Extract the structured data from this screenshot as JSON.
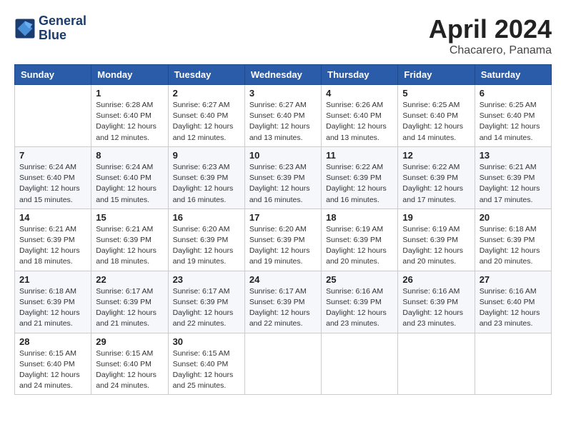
{
  "header": {
    "logo_line1": "General",
    "logo_line2": "Blue",
    "month": "April 2024",
    "location": "Chacarero, Panama"
  },
  "days_of_week": [
    "Sunday",
    "Monday",
    "Tuesday",
    "Wednesday",
    "Thursday",
    "Friday",
    "Saturday"
  ],
  "weeks": [
    [
      {
        "day": "",
        "sunrise": "",
        "sunset": "",
        "daylight": ""
      },
      {
        "day": "1",
        "sunrise": "Sunrise: 6:28 AM",
        "sunset": "Sunset: 6:40 PM",
        "daylight": "Daylight: 12 hours and 12 minutes."
      },
      {
        "day": "2",
        "sunrise": "Sunrise: 6:27 AM",
        "sunset": "Sunset: 6:40 PM",
        "daylight": "Daylight: 12 hours and 12 minutes."
      },
      {
        "day": "3",
        "sunrise": "Sunrise: 6:27 AM",
        "sunset": "Sunset: 6:40 PM",
        "daylight": "Daylight: 12 hours and 13 minutes."
      },
      {
        "day": "4",
        "sunrise": "Sunrise: 6:26 AM",
        "sunset": "Sunset: 6:40 PM",
        "daylight": "Daylight: 12 hours and 13 minutes."
      },
      {
        "day": "5",
        "sunrise": "Sunrise: 6:25 AM",
        "sunset": "Sunset: 6:40 PM",
        "daylight": "Daylight: 12 hours and 14 minutes."
      },
      {
        "day": "6",
        "sunrise": "Sunrise: 6:25 AM",
        "sunset": "Sunset: 6:40 PM",
        "daylight": "Daylight: 12 hours and 14 minutes."
      }
    ],
    [
      {
        "day": "7",
        "sunrise": "Sunrise: 6:24 AM",
        "sunset": "Sunset: 6:40 PM",
        "daylight": "Daylight: 12 hours and 15 minutes."
      },
      {
        "day": "8",
        "sunrise": "Sunrise: 6:24 AM",
        "sunset": "Sunset: 6:40 PM",
        "daylight": "Daylight: 12 hours and 15 minutes."
      },
      {
        "day": "9",
        "sunrise": "Sunrise: 6:23 AM",
        "sunset": "Sunset: 6:39 PM",
        "daylight": "Daylight: 12 hours and 16 minutes."
      },
      {
        "day": "10",
        "sunrise": "Sunrise: 6:23 AM",
        "sunset": "Sunset: 6:39 PM",
        "daylight": "Daylight: 12 hours and 16 minutes."
      },
      {
        "day": "11",
        "sunrise": "Sunrise: 6:22 AM",
        "sunset": "Sunset: 6:39 PM",
        "daylight": "Daylight: 12 hours and 16 minutes."
      },
      {
        "day": "12",
        "sunrise": "Sunrise: 6:22 AM",
        "sunset": "Sunset: 6:39 PM",
        "daylight": "Daylight: 12 hours and 17 minutes."
      },
      {
        "day": "13",
        "sunrise": "Sunrise: 6:21 AM",
        "sunset": "Sunset: 6:39 PM",
        "daylight": "Daylight: 12 hours and 17 minutes."
      }
    ],
    [
      {
        "day": "14",
        "sunrise": "Sunrise: 6:21 AM",
        "sunset": "Sunset: 6:39 PM",
        "daylight": "Daylight: 12 hours and 18 minutes."
      },
      {
        "day": "15",
        "sunrise": "Sunrise: 6:21 AM",
        "sunset": "Sunset: 6:39 PM",
        "daylight": "Daylight: 12 hours and 18 minutes."
      },
      {
        "day": "16",
        "sunrise": "Sunrise: 6:20 AM",
        "sunset": "Sunset: 6:39 PM",
        "daylight": "Daylight: 12 hours and 19 minutes."
      },
      {
        "day": "17",
        "sunrise": "Sunrise: 6:20 AM",
        "sunset": "Sunset: 6:39 PM",
        "daylight": "Daylight: 12 hours and 19 minutes."
      },
      {
        "day": "18",
        "sunrise": "Sunrise: 6:19 AM",
        "sunset": "Sunset: 6:39 PM",
        "daylight": "Daylight: 12 hours and 20 minutes."
      },
      {
        "day": "19",
        "sunrise": "Sunrise: 6:19 AM",
        "sunset": "Sunset: 6:39 PM",
        "daylight": "Daylight: 12 hours and 20 minutes."
      },
      {
        "day": "20",
        "sunrise": "Sunrise: 6:18 AM",
        "sunset": "Sunset: 6:39 PM",
        "daylight": "Daylight: 12 hours and 20 minutes."
      }
    ],
    [
      {
        "day": "21",
        "sunrise": "Sunrise: 6:18 AM",
        "sunset": "Sunset: 6:39 PM",
        "daylight": "Daylight: 12 hours and 21 minutes."
      },
      {
        "day": "22",
        "sunrise": "Sunrise: 6:17 AM",
        "sunset": "Sunset: 6:39 PM",
        "daylight": "Daylight: 12 hours and 21 minutes."
      },
      {
        "day": "23",
        "sunrise": "Sunrise: 6:17 AM",
        "sunset": "Sunset: 6:39 PM",
        "daylight": "Daylight: 12 hours and 22 minutes."
      },
      {
        "day": "24",
        "sunrise": "Sunrise: 6:17 AM",
        "sunset": "Sunset: 6:39 PM",
        "daylight": "Daylight: 12 hours and 22 minutes."
      },
      {
        "day": "25",
        "sunrise": "Sunrise: 6:16 AM",
        "sunset": "Sunset: 6:39 PM",
        "daylight": "Daylight: 12 hours and 23 minutes."
      },
      {
        "day": "26",
        "sunrise": "Sunrise: 6:16 AM",
        "sunset": "Sunset: 6:39 PM",
        "daylight": "Daylight: 12 hours and 23 minutes."
      },
      {
        "day": "27",
        "sunrise": "Sunrise: 6:16 AM",
        "sunset": "Sunset: 6:40 PM",
        "daylight": "Daylight: 12 hours and 23 minutes."
      }
    ],
    [
      {
        "day": "28",
        "sunrise": "Sunrise: 6:15 AM",
        "sunset": "Sunset: 6:40 PM",
        "daylight": "Daylight: 12 hours and 24 minutes."
      },
      {
        "day": "29",
        "sunrise": "Sunrise: 6:15 AM",
        "sunset": "Sunset: 6:40 PM",
        "daylight": "Daylight: 12 hours and 24 minutes."
      },
      {
        "day": "30",
        "sunrise": "Sunrise: 6:15 AM",
        "sunset": "Sunset: 6:40 PM",
        "daylight": "Daylight: 12 hours and 25 minutes."
      },
      {
        "day": "",
        "sunrise": "",
        "sunset": "",
        "daylight": ""
      },
      {
        "day": "",
        "sunrise": "",
        "sunset": "",
        "daylight": ""
      },
      {
        "day": "",
        "sunrise": "",
        "sunset": "",
        "daylight": ""
      },
      {
        "day": "",
        "sunrise": "",
        "sunset": "",
        "daylight": ""
      }
    ]
  ]
}
